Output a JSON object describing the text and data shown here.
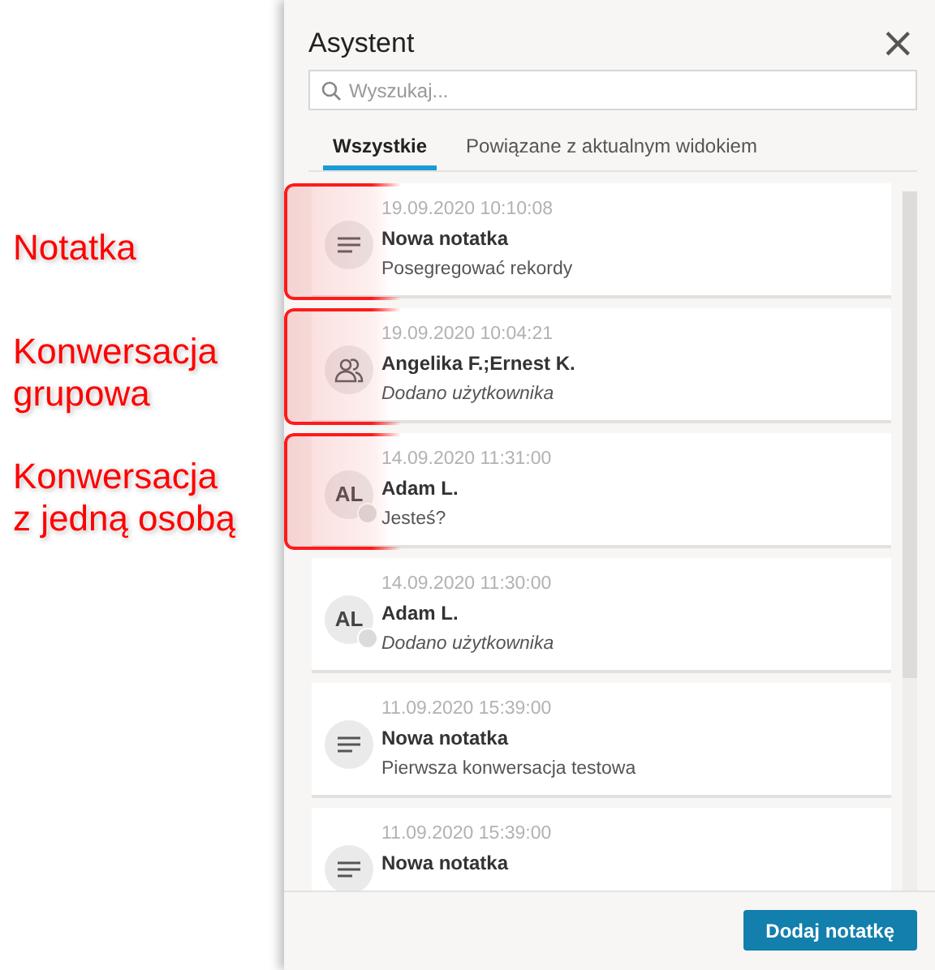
{
  "panel": {
    "title": "Asystent",
    "close": "×",
    "search": {
      "placeholder": "Wyszukaj..."
    },
    "tabs": [
      {
        "label": "Wszystkie",
        "selected": true
      },
      {
        "label": "Powiązane z aktualnym widokiem",
        "selected": false
      }
    ],
    "items": [
      {
        "kind": "note",
        "time": "19.09.2020 10:10:08",
        "title": "Nowa notatka",
        "text": "Posegregować rekordy",
        "system": false,
        "callout": [
          "Notatka"
        ]
      },
      {
        "kind": "group",
        "time": "19.09.2020 10:04:21",
        "title": "Angelika F.;Ernest K.",
        "text": "Dodano użytkownika",
        "system": true,
        "callout": [
          "Konwersacja",
          "grupowa"
        ]
      },
      {
        "kind": "person",
        "initials": "AL",
        "time": "14.09.2020 11:31:00",
        "title": "Adam L.",
        "text": "Jesteś?",
        "system": false,
        "callout": [
          "Konwersacja",
          "z jedną osobą"
        ]
      },
      {
        "kind": "person",
        "initials": "AL",
        "time": "14.09.2020 11:30:00",
        "title": "Adam L.",
        "text": "Dodano użytkownika",
        "system": true
      },
      {
        "kind": "note",
        "time": "11.09.2020 15:39:00",
        "title": "Nowa notatka",
        "text": "Pierwsza konwersacja testowa",
        "system": false
      },
      {
        "kind": "note",
        "time": "11.09.2020 15:39:00",
        "title": "Nowa notatka"
      }
    ],
    "button": "Dodaj notatkę"
  }
}
